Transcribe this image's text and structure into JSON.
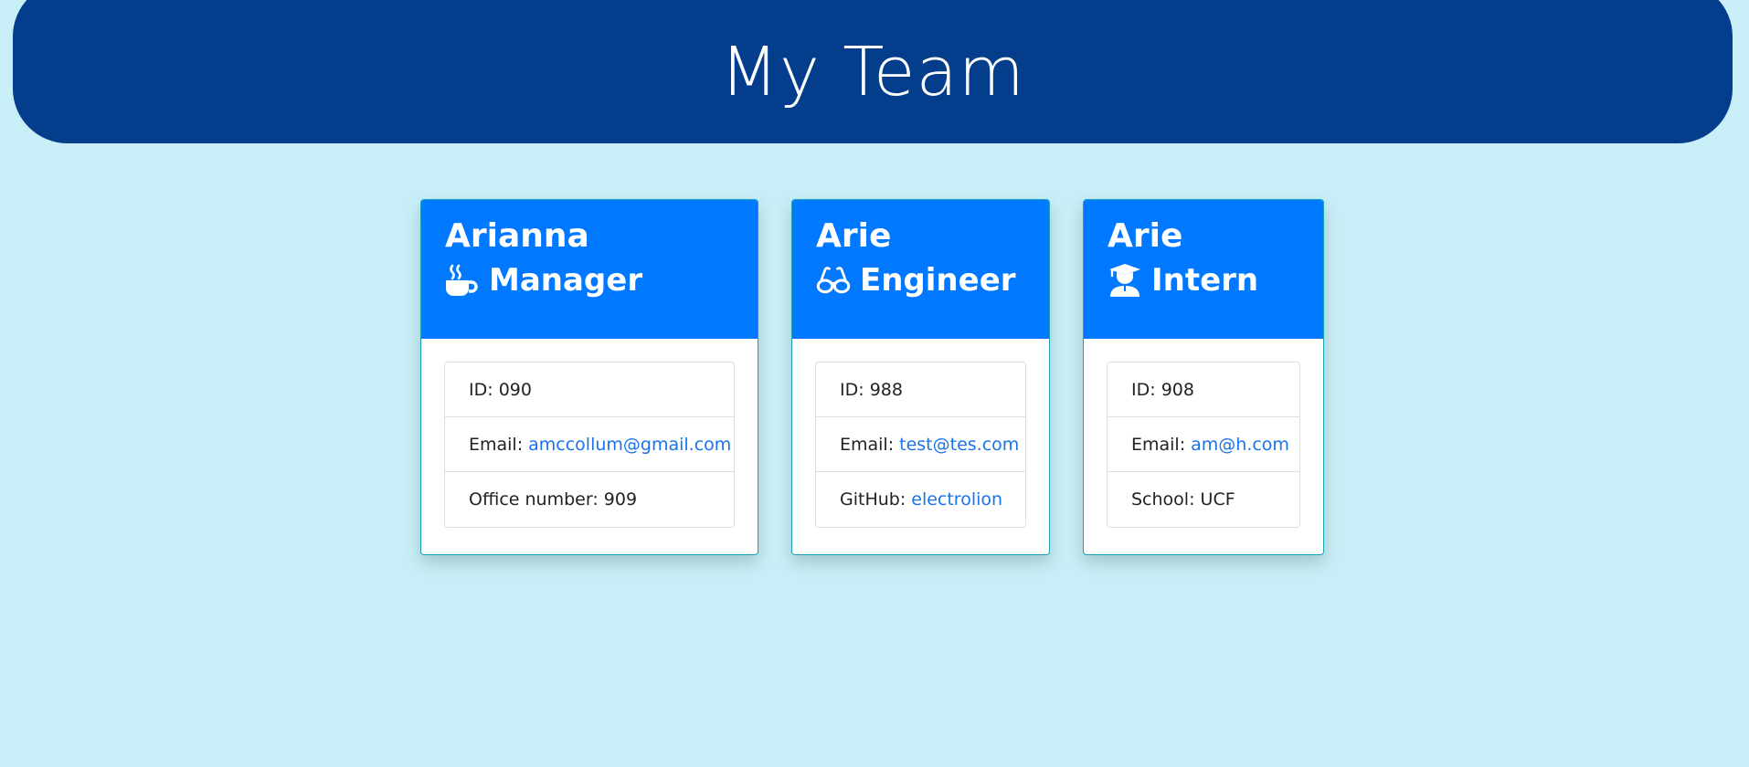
{
  "header": {
    "title": "My Team"
  },
  "cards": [
    {
      "name": "Arianna",
      "role": "Manager",
      "icon": "coffee-icon",
      "id_label": "ID:",
      "id_value": "090",
      "email_label": "Email:",
      "email_value": "amccollum@gmail.com",
      "extra_label": "Office number:",
      "extra_value": "909"
    },
    {
      "name": "Arie",
      "role": "Engineer",
      "icon": "glasses-icon",
      "id_label": "ID:",
      "id_value": "988",
      "email_label": "Email:",
      "email_value": "test@tes.com",
      "extra_label": "GitHub:",
      "extra_value": "electrolion"
    },
    {
      "name": "Arie",
      "role": "Intern",
      "icon": "graduate-icon",
      "id_label": "ID:",
      "id_value": "908",
      "email_label": "Email:",
      "email_value": "am@h.com",
      "extra_label": "School:",
      "extra_value": "UCF"
    }
  ],
  "colors": {
    "background": "#c8eff7",
    "header": "#033d8c",
    "card_header": "#0078ff",
    "link": "#1a73e8"
  }
}
